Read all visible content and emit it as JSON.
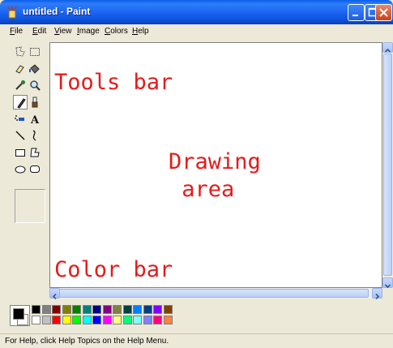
{
  "window": {
    "title": "untitled - Paint",
    "app_icon": "paint-cup-icon"
  },
  "menu": {
    "items": [
      {
        "label": "File",
        "accel": "F",
        "rest": "ile"
      },
      {
        "label": "Edit",
        "accel": "E",
        "rest": "dit"
      },
      {
        "label": "View",
        "accel": "V",
        "rest": "iew"
      },
      {
        "label": "Image",
        "accel": "I",
        "rest": "mage"
      },
      {
        "label": "Colors",
        "accel": "C",
        "rest": "olors"
      },
      {
        "label": "Help",
        "accel": "H",
        "rest": "elp"
      }
    ]
  },
  "tools": [
    {
      "name": "free-form-select",
      "icon": "free-form-select-icon"
    },
    {
      "name": "select",
      "icon": "rect-select-icon"
    },
    {
      "name": "eraser",
      "icon": "eraser-icon"
    },
    {
      "name": "fill-with-color",
      "icon": "paint-bucket-icon"
    },
    {
      "name": "pick-color",
      "icon": "eyedropper-icon"
    },
    {
      "name": "magnifier",
      "icon": "magnifier-icon"
    },
    {
      "name": "pencil",
      "icon": "pencil-icon",
      "selected": true
    },
    {
      "name": "brush",
      "icon": "brush-icon"
    },
    {
      "name": "airbrush",
      "icon": "airbrush-icon"
    },
    {
      "name": "text",
      "icon": "text-icon"
    },
    {
      "name": "line",
      "icon": "line-icon"
    },
    {
      "name": "curve",
      "icon": "curve-icon"
    },
    {
      "name": "rectangle",
      "icon": "rectangle-icon"
    },
    {
      "name": "polygon",
      "icon": "polygon-icon"
    },
    {
      "name": "ellipse",
      "icon": "ellipse-icon"
    },
    {
      "name": "rounded-rectangle",
      "icon": "rounded-rectangle-icon"
    }
  ],
  "canvas": {
    "annotations": {
      "tools_bar": "Tools bar",
      "drawing_area": "Drawing\n area",
      "color_bar": "Color bar"
    },
    "annotation_color": "#e41b1b"
  },
  "colors": {
    "foreground": "#000000",
    "background": "#ffffff",
    "palette_top": [
      "#000000",
      "#808080",
      "#800000",
      "#808000",
      "#008000",
      "#008080",
      "#000080",
      "#800080",
      "#808040",
      "#004040",
      "#0080ff",
      "#004080",
      "#8000ff",
      "#804000"
    ],
    "palette_bottom": [
      "#ffffff",
      "#c0c0c0",
      "#ff0000",
      "#ffff00",
      "#00ff00",
      "#00ffff",
      "#0000ff",
      "#ff00ff",
      "#ffff80",
      "#00ff80",
      "#80ffff",
      "#8080ff",
      "#ff0080",
      "#ff8040"
    ]
  },
  "status": {
    "text": "For Help, click Help Topics on the Help Menu."
  }
}
